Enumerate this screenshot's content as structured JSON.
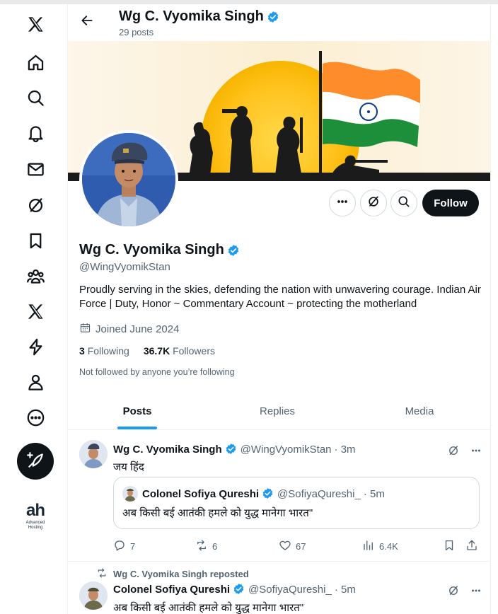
{
  "colors": {
    "accent": "#1d9bf0",
    "text": "#0f1419",
    "muted": "#536471",
    "verified": "#1d9bf0",
    "follow_bg": "#0f1419"
  },
  "nav": {
    "items": [
      {
        "name": "x-logo-icon"
      },
      {
        "name": "home-icon"
      },
      {
        "name": "explore-icon"
      },
      {
        "name": "notifications-icon"
      },
      {
        "name": "messages-icon"
      },
      {
        "name": "grok-icon"
      },
      {
        "name": "bookmarks-icon"
      },
      {
        "name": "communities-icon"
      },
      {
        "name": "premium-icon"
      },
      {
        "name": "verified-orgs-icon"
      },
      {
        "name": "profile-icon"
      },
      {
        "name": "more-icon"
      }
    ],
    "post_button_icon": "compose-icon",
    "sponsor_logo": {
      "main": "ah",
      "line1": "Advanced",
      "line2": "Hosting"
    }
  },
  "header": {
    "name": "Wg C. Vyomika Singh",
    "post_count": "29 posts"
  },
  "profile": {
    "name": "Wg C. Vyomika Singh",
    "handle": "@WingVyomikStan",
    "bio": "Proudly serving in the skies, defending the nation with unwavering courage. Indian Air Force | Duty, Honor ~ Commentary Account ~  protecting the motherland",
    "joined": "Joined June 2024",
    "following_count": "3",
    "following_label": "Following",
    "followers_count": "36.7K",
    "followers_label": "Followers",
    "not_followed": "Not followed by anyone you’re following",
    "follow_label": "Follow"
  },
  "tabs": [
    {
      "label": "Posts",
      "active": true
    },
    {
      "label": "Replies",
      "active": false
    },
    {
      "label": "Media",
      "active": false
    }
  ],
  "tweets": [
    {
      "author": "Wg C. Vyomika Singh",
      "handle": "@WingVyomikStan",
      "time": "· 3m",
      "text": "जय हिंद",
      "quote": {
        "author": "Colonel Sofiya Qureshi",
        "handle": "@SofiyaQureshi_",
        "time": "· 5m",
        "text": "अब किसी बई आतंकी हमले को युद्ध मानेगा भारत\""
      },
      "replies": "7",
      "reposts": "6",
      "likes": "67",
      "views": "6.4K"
    },
    {
      "repost_by": "Wg C. Vyomika Singh reposted",
      "author": "Colonel Sofiya Qureshi",
      "handle": "@SofiyaQureshi_",
      "time": "· 5m",
      "text": "अब किसी बई आतंकी हमले को युद्ध मानेगा भारत\""
    }
  ]
}
